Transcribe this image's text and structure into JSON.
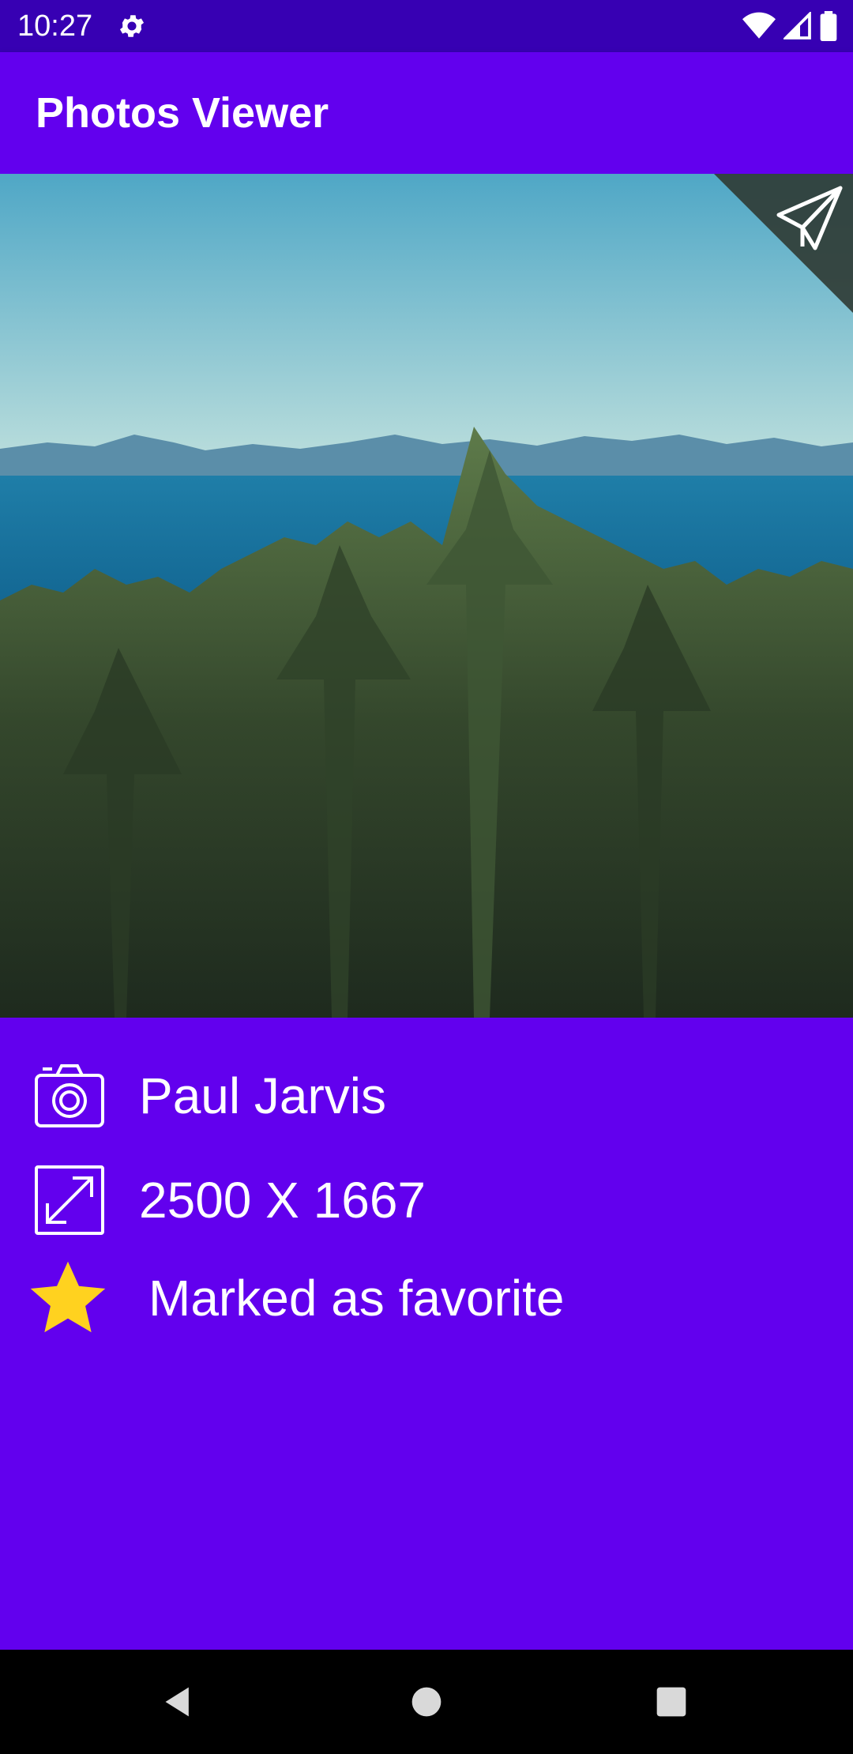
{
  "status_bar": {
    "time": "10:27",
    "icons": [
      "settings-gear-icon",
      "wifi-icon",
      "signal-icon",
      "battery-icon"
    ]
  },
  "app_bar": {
    "title": "Photos Viewer"
  },
  "photo": {
    "share_icon": "send-paper-plane-icon"
  },
  "details": {
    "author": "Paul Jarvis",
    "dimensions": "2500 X 1667",
    "favorite_label": "Marked as favorite",
    "icons": [
      "camera-icon",
      "resize-icon",
      "star-icon"
    ]
  },
  "colors": {
    "primary": "#6200EE",
    "primary_dark": "#3700B3",
    "star": "#FFD21F"
  },
  "nav": {
    "icons": [
      "back-icon",
      "home-icon",
      "recents-icon"
    ]
  }
}
